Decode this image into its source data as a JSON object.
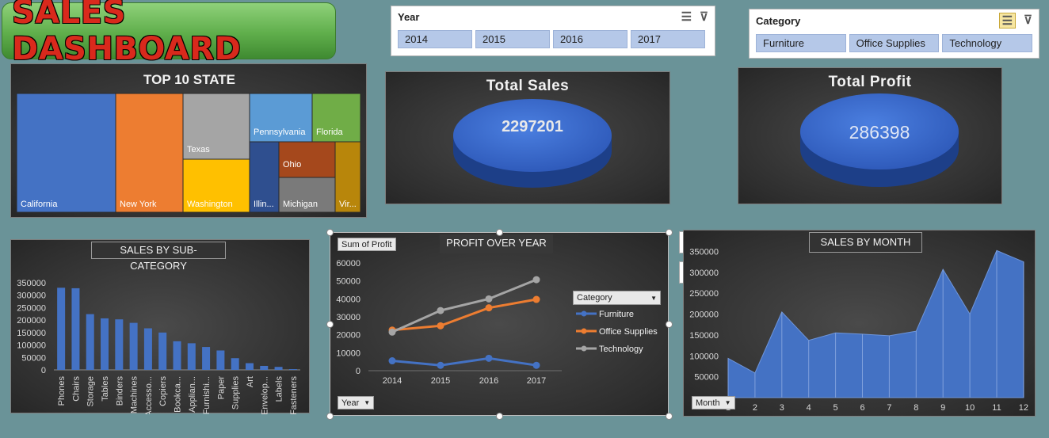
{
  "dashboard": {
    "title": "SALES DASHBOARD"
  },
  "year_slicer": {
    "title": "Year",
    "items": [
      "2014",
      "2015",
      "2016",
      "2017"
    ]
  },
  "category_slicer": {
    "title": "Category",
    "items": [
      "Furniture",
      "Office Supplies",
      "Technology"
    ]
  },
  "kpi": {
    "sales_title": "Total Sales",
    "sales_value": "2297201",
    "profit_title": "Total Profit",
    "profit_value": "286398"
  },
  "colors": {
    "blue": "#4472c4",
    "orange": "#ed7d31",
    "gray": "#a5a5a5",
    "green_banner": "#5fae4b",
    "title_red": "#d9291c"
  },
  "chart_data": [
    {
      "type": "treemap",
      "title": "TOP 10 STATE",
      "categories": [
        "California",
        "New York",
        "Texas",
        "Washington",
        "Pennsylvania",
        "Florida",
        "Illin...",
        "Ohio",
        "Michigan",
        "Vir..."
      ],
      "colors": [
        "#4472c4",
        "#ed7d31",
        "#a5a5a5",
        "#ffc000",
        "#5b9bd5",
        "#70ad47",
        "#2f4f8f",
        "#a5481c",
        "#7a7a7a",
        "#b8860b"
      ]
    },
    {
      "type": "bar",
      "title": "SALES BY SUB-CATEGORY",
      "categories": [
        "Phones",
        "Chairs",
        "Storage",
        "Tables",
        "Binders",
        "Machines",
        "Accesso...",
        "Copiers",
        "Bookca...",
        "Applian...",
        "Furnishi...",
        "Paper",
        "Supplies",
        "Art",
        "Envelop...",
        "Labels",
        "Fasteners"
      ],
      "values": [
        330000,
        328000,
        224000,
        207000,
        203000,
        189000,
        167000,
        150000,
        115000,
        107000,
        92000,
        78000,
        47000,
        27000,
        16000,
        12000,
        3000
      ],
      "yticks": [
        "0",
        "50000",
        "100000",
        "150000",
        "200000",
        "250000",
        "300000",
        "350000"
      ],
      "ylim": [
        0,
        350000
      ]
    },
    {
      "type": "line",
      "title": "PROFIT OVER YEAR",
      "value_field": "Sum of Profit",
      "axis_field": "Year",
      "legend_title": "Category",
      "x": [
        "2014",
        "2015",
        "2016",
        "2017"
      ],
      "yticks": [
        "0",
        "10000",
        "20000",
        "30000",
        "40000",
        "50000",
        "60000"
      ],
      "ylim": [
        0,
        60000
      ],
      "series": [
        {
          "name": "Furniture",
          "values": [
            5500,
            3000,
            6900,
            3000
          ]
        },
        {
          "name": "Office Supplies",
          "values": [
            22600,
            25000,
            35000,
            39700
          ]
        },
        {
          "name": "Technology",
          "values": [
            21500,
            33500,
            40000,
            50700
          ]
        }
      ]
    },
    {
      "type": "area",
      "title": "SALES BY MONTH",
      "axis_field": "Month",
      "x": [
        "1",
        "2",
        "3",
        "4",
        "5",
        "6",
        "7",
        "8",
        "9",
        "10",
        "11",
        "12"
      ],
      "values": [
        94000,
        59000,
        205000,
        137000,
        155000,
        152000,
        148000,
        159000,
        307000,
        200000,
        352000,
        325000
      ],
      "yticks": [
        "0",
        "50000",
        "100000",
        "150000",
        "200000",
        "250000",
        "300000",
        "350000"
      ],
      "ylim": [
        0,
        400000
      ]
    }
  ]
}
